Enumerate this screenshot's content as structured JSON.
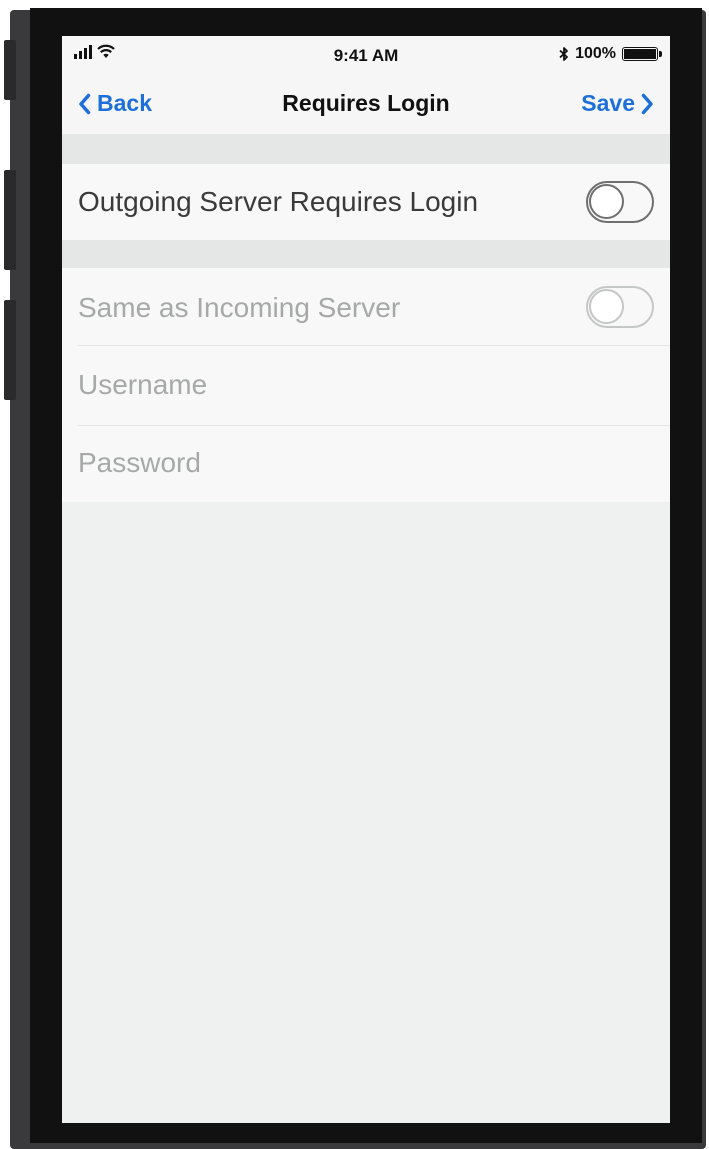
{
  "status_bar": {
    "time": "9:41 AM",
    "battery_text": "100%",
    "battery_level": 1.0,
    "icons": [
      "signal-icon",
      "wifi-icon",
      "bluetooth-icon",
      "battery-icon"
    ]
  },
  "nav": {
    "back_label": "Back",
    "title": "Requires Login",
    "save_label": "Save"
  },
  "rows": {
    "outgoing_requires_login": {
      "label": "Outgoing Server Requires Login",
      "toggle_on": false
    },
    "same_as_incoming": {
      "label": "Same as Incoming Server",
      "toggle_on": false,
      "disabled": true
    },
    "username": {
      "placeholder": "Username",
      "value": ""
    },
    "password": {
      "placeholder": "Password",
      "value": ""
    }
  },
  "colors": {
    "accent": "#1e6fd9",
    "label_active": "#3a3a3a",
    "label_disabled": "#a7a9a8",
    "screen_background": "#eef1ef"
  }
}
